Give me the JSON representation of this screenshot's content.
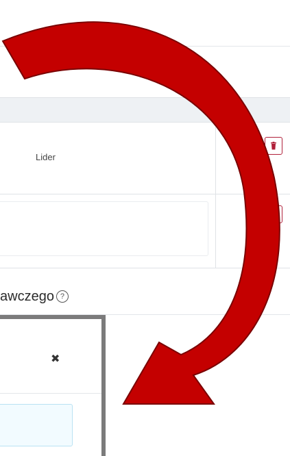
{
  "table": {
    "rows": [
      {
        "role": "Lider"
      },
      {
        "role": ""
      }
    ]
  },
  "section": {
    "title": "awczego",
    "help_glyph": "?"
  },
  "modal": {
    "close_glyph": "✖"
  },
  "colors": {
    "arrow": "#c40000",
    "arrow_outline": "#7a0000",
    "delete_accent": "#b0203a",
    "modal_frame": "#7b7b7b"
  }
}
